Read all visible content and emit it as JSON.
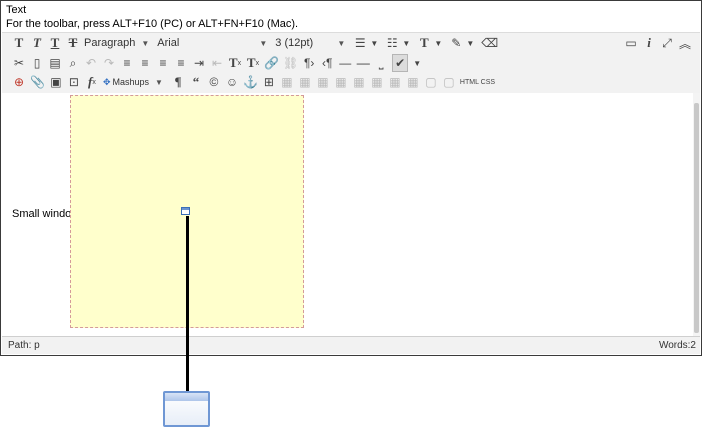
{
  "field": {
    "label": "Text",
    "hint": "For the toolbar, press ALT+F10 (PC) or ALT+FN+F10 (Mac)."
  },
  "toolbar": {
    "row1": {
      "paragraph": "Paragraph",
      "font": "Arial",
      "size": "3 (12pt)"
    },
    "row2": {
      "mashups": "Mashups"
    },
    "row3": {
      "html_css": "HTML CSS"
    }
  },
  "content": {
    "side_label": "Small window"
  },
  "status": {
    "path": "Path: p",
    "words": "Words:2"
  },
  "colors": {
    "yellow_box": "#ffffcc",
    "window_blue": "#6f97d4"
  }
}
